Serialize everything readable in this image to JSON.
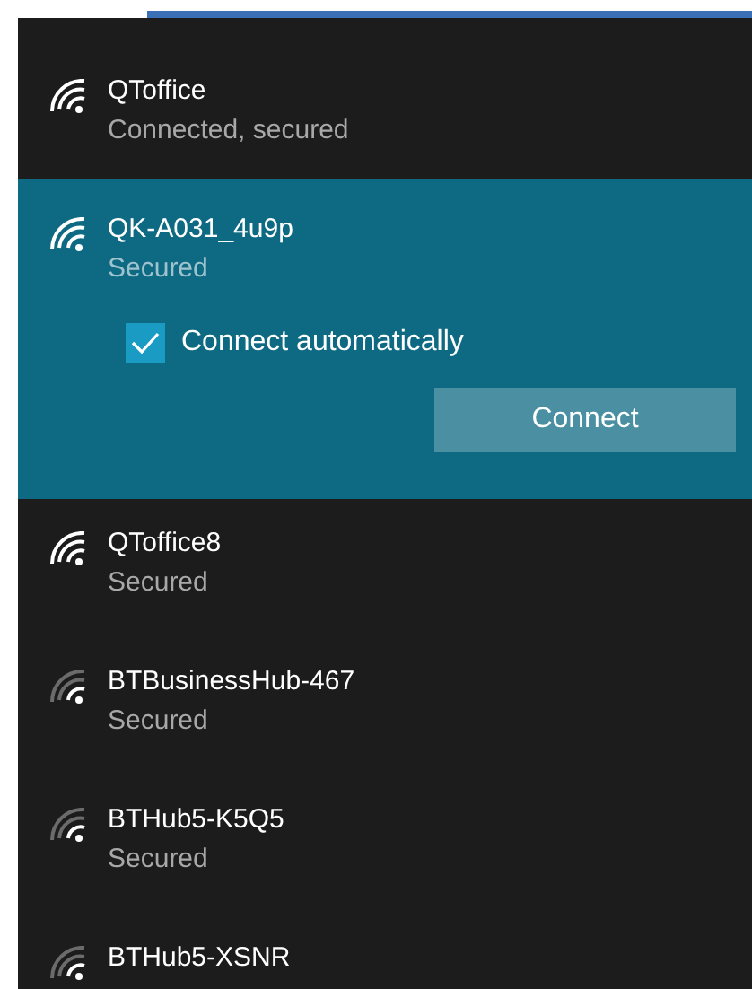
{
  "networks": [
    {
      "name": "QToffice",
      "status": "Connected, secured",
      "kind": "strong",
      "selected": false
    },
    {
      "name": "QK-A031_4u9p",
      "status": "Secured",
      "kind": "strong",
      "selected": true,
      "connect_automatically": {
        "label": "Connect automatically",
        "checked": true
      },
      "button": "Connect"
    },
    {
      "name": "QToffice8",
      "status": "Secured",
      "kind": "strong",
      "selected": false
    },
    {
      "name": "BTBusinessHub-467",
      "status": "Secured",
      "kind": "weak",
      "selected": false
    },
    {
      "name": "BTHub5-K5Q5",
      "status": "Secured",
      "kind": "weak",
      "selected": false
    },
    {
      "name": "BTHub5-XSNR",
      "kind": "weak",
      "selected": false
    }
  ]
}
